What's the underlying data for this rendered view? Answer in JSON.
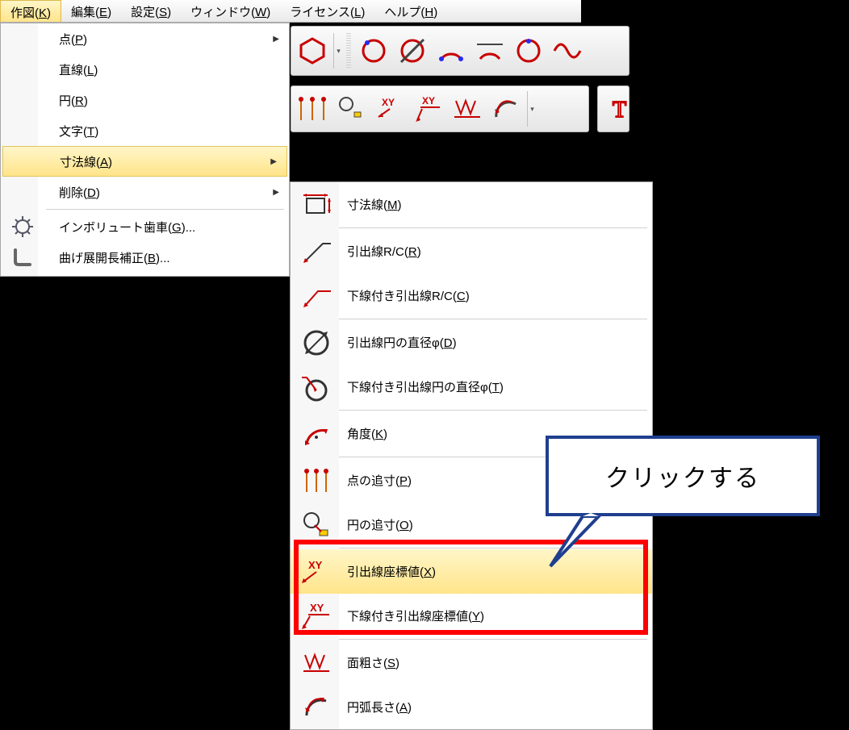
{
  "menubar": [
    {
      "label": "作図",
      "accel": "K",
      "active": true
    },
    {
      "label": "編集",
      "accel": "E"
    },
    {
      "label": "設定",
      "accel": "S"
    },
    {
      "label": "ウィンドウ",
      "accel": "W"
    },
    {
      "label": "ライセンス",
      "accel": "L"
    },
    {
      "label": "ヘルプ",
      "accel": "H"
    }
  ],
  "flyout": {
    "items": [
      {
        "label": "点",
        "accel": "P",
        "sub": true
      },
      {
        "label": "直線",
        "accel": "L"
      },
      {
        "label": "円",
        "accel": "R"
      },
      {
        "label": "文字",
        "accel": "T"
      },
      {
        "label": "寸法線",
        "accel": "A",
        "sub": true,
        "hover": true
      },
      {
        "label": "削除",
        "accel": "D",
        "sub": true
      },
      {
        "sep": true
      },
      {
        "label": "インボリュート歯車",
        "accel": "G",
        "trail": "...",
        "icon": "gear-icon"
      },
      {
        "label": "曲げ展開長補正",
        "accel": "B",
        "trail": "...",
        "icon": "bend-icon"
      }
    ]
  },
  "submenu": {
    "items": [
      {
        "label": "寸法線",
        "accel": "M",
        "icon": "dim-box-icon"
      },
      {
        "label": "引出線R/C",
        "accel": "R",
        "icon": "leader-icon"
      },
      {
        "label": "下線付き引出線R/C",
        "accel": "C",
        "icon": "leader-underline-icon"
      },
      {
        "label": "引出線円の直径φ",
        "accel": "D",
        "icon": "diameter-icon"
      },
      {
        "label": "下線付き引出線円の直径φ",
        "accel": "T",
        "icon": "diameter-underline-icon"
      },
      {
        "label": "角度",
        "accel": "K",
        "icon": "angle-icon"
      },
      {
        "label": "点の追寸",
        "accel": "P",
        "icon": "point-dim-icon"
      },
      {
        "label": "円の追寸",
        "accel": "O",
        "icon": "circle-dim-icon"
      },
      {
        "label": "引出線座標値",
        "accel": "X",
        "icon": "xy-leader-icon",
        "hover": true,
        "highlight": true
      },
      {
        "label": "下線付き引出線座標値",
        "accel": "Y",
        "icon": "xy-leader-underline-icon",
        "highlight": true
      },
      {
        "label": "面粗さ",
        "accel": "S",
        "icon": "roughness-icon"
      },
      {
        "label": "円弧長さ",
        "accel": "A",
        "icon": "arclen-icon"
      }
    ]
  },
  "callout": {
    "text": "クリックする"
  }
}
